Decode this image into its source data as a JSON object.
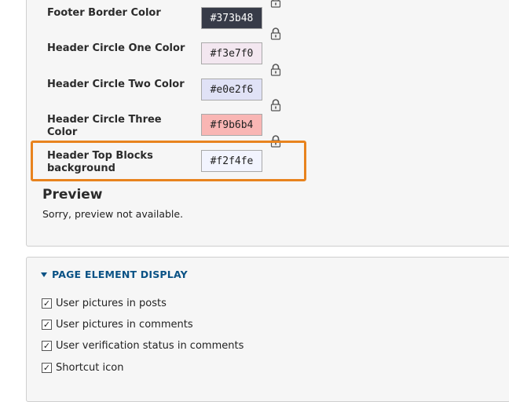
{
  "color_settings": [
    {
      "label": "Footer Border Color",
      "value": "#373b48",
      "bg": "#373b48",
      "fg": "#ffffff"
    },
    {
      "label": "Header Circle One Color",
      "value": "#f3e7f0",
      "bg": "#f3e7f0",
      "fg": "#222222"
    },
    {
      "label": "Header Circle Two Color",
      "value": "#e0e2f6",
      "bg": "#e0e2f6",
      "fg": "#222222"
    },
    {
      "label": "Header Circle Three Color",
      "value": "#f9b6b4",
      "bg": "#f9b6b4",
      "fg": "#222222"
    },
    {
      "label": "Header Top Blocks background",
      "value": "#f2f4fe",
      "bg": "#f2f4fe",
      "fg": "#222222"
    }
  ],
  "preview": {
    "title": "Preview",
    "message": "Sorry, preview not available."
  },
  "page_element_display": {
    "title": "PAGE ELEMENT DISPLAY",
    "options": [
      {
        "label": "User pictures in posts",
        "checked": true
      },
      {
        "label": "User pictures in comments",
        "checked": true
      },
      {
        "label": "User verification status in comments",
        "checked": true
      },
      {
        "label": "Shortcut icon",
        "checked": true
      }
    ]
  },
  "colors": {
    "highlight": "#e8831e",
    "link": "#0a5285"
  }
}
